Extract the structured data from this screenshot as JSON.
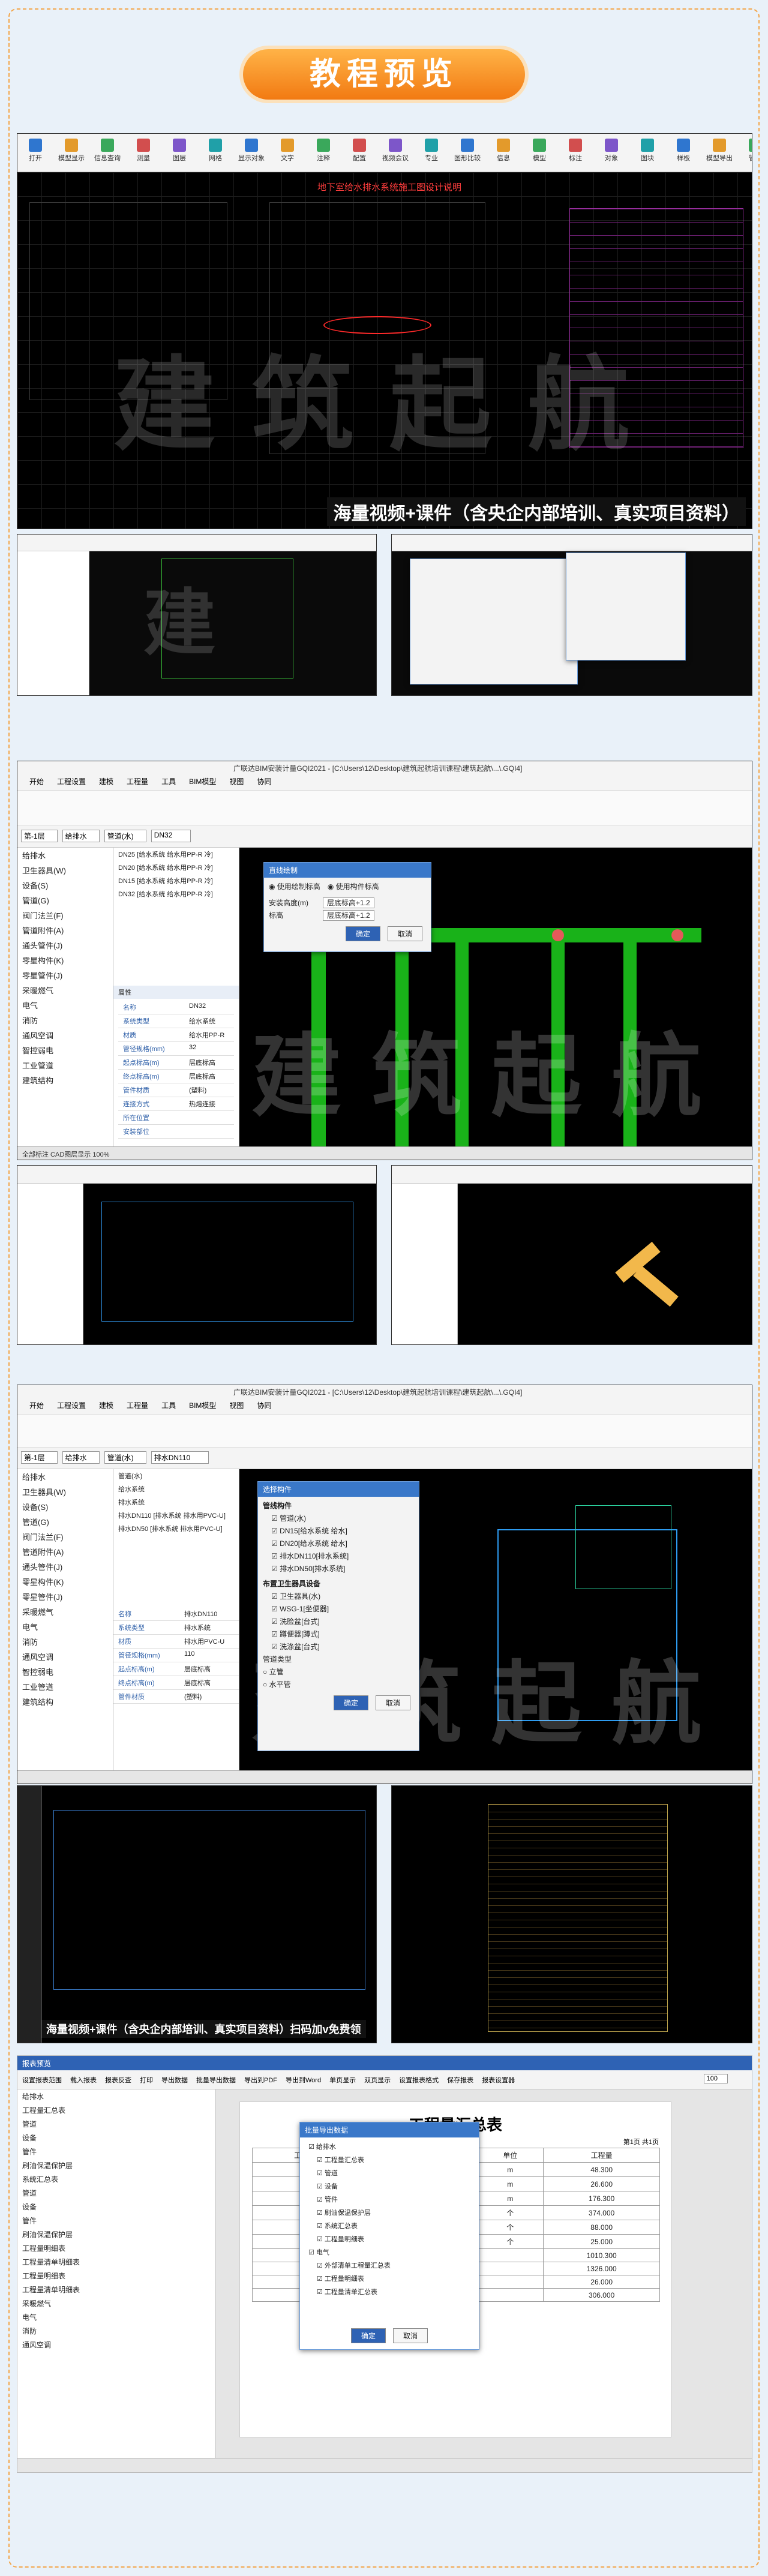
{
  "header": {
    "title": "教程预览"
  },
  "panel1": {
    "caption": "海量视频+课件（含央企内部培训、真实项目资料）",
    "watermark": "建筑起航",
    "tools": [
      "打开",
      "模型显示",
      "信息查询",
      "测量",
      "图层",
      "网格",
      "显示对象",
      "文字",
      "注释",
      "配置",
      "视频会议",
      "专业",
      "图形比较",
      "信息",
      "模型",
      "标注",
      "对象",
      "图块",
      "样板",
      "模型导出",
      "管理"
    ],
    "heading": "地下室给水排水系统施工图设计说明"
  },
  "panel3": {
    "title": "广联达BIM安装计量GQI2021 - [C:\\Users\\12\\Desktop\\建筑起航培训课程\\建筑起航\\...\\.GQI4]",
    "menu": [
      "开始",
      "工程设置",
      "建模",
      "工程量",
      "工具",
      "BIM模型",
      "视图",
      "协同"
    ],
    "floor": "第-1层",
    "system": "给排水",
    "component": "管道(水)",
    "pipe_size": "DN32",
    "tree": [
      "给排水",
      "卫生器具(W)",
      "设备(S)",
      "管道(G)",
      "阀门法兰(F)",
      "管道附件(A)",
      "通头管件(J)",
      "零星构件(K)",
      "零星管件(J)",
      "采暖燃气",
      "电气",
      "消防",
      "通风空调",
      "智控弱电",
      "工业管道",
      "建筑结构"
    ],
    "list": [
      "DN25 [给水系统 给水用PP-R 冷]",
      "DN20 [给水系统 给水用PP-R 冷]",
      "DN15 [给水系统 给水用PP-R 冷]",
      "DN32 [给水系统 给水用PP-R 冷]"
    ],
    "props_title": "属性",
    "props": [
      [
        "名称",
        "DN32"
      ],
      [
        "系统类型",
        "给水系统"
      ],
      [
        "材质",
        "给水用PP-R"
      ],
      [
        "管径规格(mm)",
        "32"
      ],
      [
        "起点标高(m)",
        "层底标高"
      ],
      [
        "终点标高(m)",
        "层底标高"
      ],
      [
        "管件材质",
        "(塑料)"
      ],
      [
        "连接方式",
        "热熔连接"
      ],
      [
        "所在位置",
        ""
      ],
      [
        "安装部位",
        ""
      ]
    ],
    "dialog_title": "直线绘制",
    "dialog_options": [
      "使用绘制标高",
      "使用构件标高"
    ],
    "dialog_fields": [
      [
        "安装高度(m)",
        "层底标高+1.2"
      ],
      [
        "标高",
        "层底标高+1.2"
      ]
    ],
    "dialog_buttons": [
      "确定",
      "取消"
    ],
    "status": "全部标注 CAD图层显示 100%",
    "watermark": "建筑起航"
  },
  "panel5": {
    "title": "广联达BIM安装计量GQI2021 - [C:\\Users\\12\\Desktop\\建筑起航培训课程\\建筑起航\\...\\.GQI4]",
    "menu": [
      "开始",
      "工程设置",
      "建模",
      "工程量",
      "工具",
      "BIM模型",
      "视图",
      "协同"
    ],
    "floor": "第-1层",
    "system": "给排水",
    "component": "管道(水)",
    "pipe_size": "排水DN110",
    "tree": [
      "给排水",
      "卫生器具(W)",
      "设备(S)",
      "管道(G)",
      "阀门法兰(F)",
      "管道附件(A)",
      "通头管件(J)",
      "零星构件(K)",
      "零星管件(J)",
      "采暖燃气",
      "电气",
      "消防",
      "通风空调",
      "智控弱电",
      "工业管道",
      "建筑结构"
    ],
    "list": [
      "管道(水)",
      "给水系统",
      "排水系统",
      "排水DN110 [排水系统 排水用PVC-U]",
      "排水DN50 [排水系统 排水用PVC-U]"
    ],
    "props": [
      [
        "名称",
        "排水DN110"
      ],
      [
        "系统类型",
        "排水系统"
      ],
      [
        "材质",
        "排水用PVC-U"
      ],
      [
        "管径规格(mm)",
        "110"
      ],
      [
        "起点标高(m)",
        "层底标高"
      ],
      [
        "终点标高(m)",
        "层底标高"
      ],
      [
        "管件材质",
        "(塑料)"
      ]
    ],
    "dialog_title": "选择构件",
    "dialog_sections": [
      "管线构件",
      "布置卫生器具设备"
    ],
    "dialog_items": [
      "管道(水)",
      "DN15[给水系统 给水]",
      "DN20[给水系统 给水]",
      "排水DN110[排水系统]",
      "排水DN50[排水系统]",
      "卫生器具(水)",
      "WSG-1[坐便器]",
      "洗脸盆[台式]",
      "蹲便器[蹲式]",
      "洗涤盆[台式]"
    ],
    "dialog_footer": [
      "管道类型",
      "立管",
      "水平管"
    ],
    "dialog_buttons": [
      "确定",
      "取消"
    ],
    "watermark": "建筑起航"
  },
  "panel6": {
    "caption": "海量视频+课件（含央企内部培训、真实项目资料）扫码加v免费领"
  },
  "panel7": {
    "title": "报表预览",
    "tools": [
      "设置报表范围",
      "载入报表",
      "报表反查",
      "打印",
      "导出数据",
      "批量导出数据",
      "导出到PDF",
      "导出到Word",
      "单页显示",
      "双页显示",
      "设置报表格式",
      "保存报表",
      "报表设置器"
    ],
    "tree": [
      "给排水",
      "工程量汇总表",
      "管道",
      "设备",
      "管件",
      "刷油保温保护层",
      "系统汇总表",
      "管道",
      "设备",
      "管件",
      "刷油保温保护层",
      "工程量明细表",
      "工程量清单明细表",
      "工程量明细表",
      "工程量清单明细表",
      "采暖燃气",
      "电气",
      "消防",
      "通风空调"
    ],
    "report_title": "工程量汇总表",
    "page_info": "第1页 共1页",
    "columns": [
      "工程名称",
      "项目名称",
      "单位",
      "工程量"
    ],
    "rows": [
      [
        "管道",
        "m",
        "48.300"
      ],
      [
        "管道",
        "m",
        "26.600"
      ],
      [
        "立管",
        "m",
        "176.300"
      ],
      [
        "卫生器具",
        "个",
        "374.000"
      ],
      [
        "卫生器具",
        "个",
        "88.000"
      ],
      [
        "阀门",
        "个",
        "25.000"
      ],
      [
        "",
        "",
        "1010.300"
      ],
      [
        "",
        "",
        "1326.000"
      ],
      [
        "",
        "",
        "26.000"
      ],
      [
        "",
        "",
        "306.000"
      ]
    ],
    "dialog_title": "批量导出数据",
    "dialog_items": [
      "给排水",
      "工程量汇总表",
      "管道",
      "设备",
      "管件",
      "刷油保温保护层",
      "系统汇总表",
      "工程量明细表",
      "电气",
      "外部清单工程量汇总表",
      "工程量明细表",
      "工程量清单汇总表"
    ],
    "dialog_buttons": [
      "确定",
      "取消"
    ],
    "zoom": "100"
  }
}
